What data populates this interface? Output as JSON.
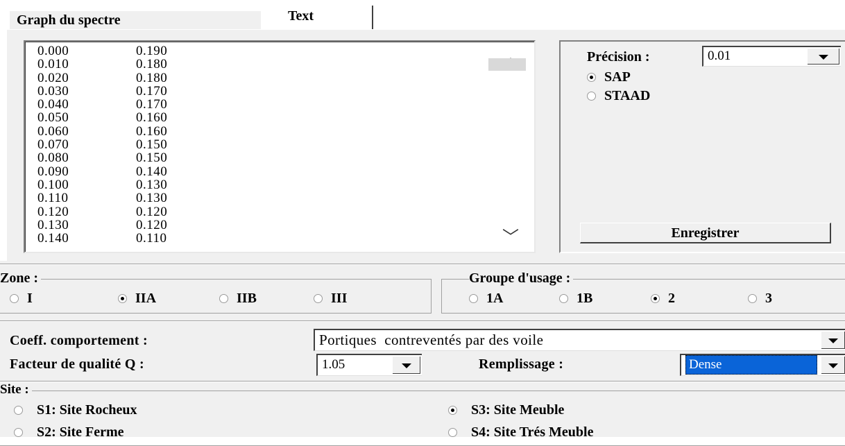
{
  "tabs": [
    {
      "label": "Graph du spectre"
    },
    {
      "label": "Text"
    }
  ],
  "list": {
    "rows": [
      [
        "0.000",
        "0.190"
      ],
      [
        "0.010",
        "0.180"
      ],
      [
        "0.020",
        "0.180"
      ],
      [
        "0.030",
        "0.170"
      ],
      [
        "0.040",
        "0.170"
      ],
      [
        "0.050",
        "0.160"
      ],
      [
        "0.060",
        "0.160"
      ],
      [
        "0.070",
        "0.150"
      ],
      [
        "0.080",
        "0.150"
      ],
      [
        "0.090",
        "0.140"
      ],
      [
        "0.100",
        "0.130"
      ],
      [
        "0.110",
        "0.130"
      ],
      [
        "0.120",
        "0.120"
      ],
      [
        "0.130",
        "0.120"
      ],
      [
        "0.140",
        "0.110"
      ]
    ]
  },
  "options": {
    "precision_label": "Précision :",
    "precision_value": "0.01",
    "format_options": [
      {
        "label": "SAP",
        "selected": true
      },
      {
        "label": "STAAD",
        "selected": false
      }
    ],
    "save_label": "Enregistrer"
  },
  "zone": {
    "title": "Zone :",
    "options": [
      {
        "label": "I",
        "selected": false
      },
      {
        "label": "IIA",
        "selected": true
      },
      {
        "label": "IIB",
        "selected": false
      },
      {
        "label": "III",
        "selected": false
      }
    ]
  },
  "usage": {
    "title": "Groupe d'usage :",
    "options": [
      {
        "label": "1A",
        "selected": false
      },
      {
        "label": "1B",
        "selected": false
      },
      {
        "label": "2",
        "selected": true
      },
      {
        "label": "3",
        "selected": false
      }
    ]
  },
  "coeff": {
    "label": "Coeff. comportement :",
    "value": "Portiques  contreventés par des voile"
  },
  "quality": {
    "label": "Facteur de qualité Q :",
    "value": "1.05"
  },
  "fill": {
    "label": "Remplissage :",
    "value": "Dense"
  },
  "site": {
    "title": "Site :",
    "options": [
      {
        "label": "S1: Site Rocheux",
        "selected": false
      },
      {
        "label": "S2: Site Ferme",
        "selected": false
      },
      {
        "label": "S3: Site Meuble",
        "selected": true
      },
      {
        "label": "S4: Site Trés Meuble",
        "selected": false
      }
    ]
  },
  "colors": {
    "panel_bg": "#f0f0f0",
    "selection": "#0a64d8"
  }
}
